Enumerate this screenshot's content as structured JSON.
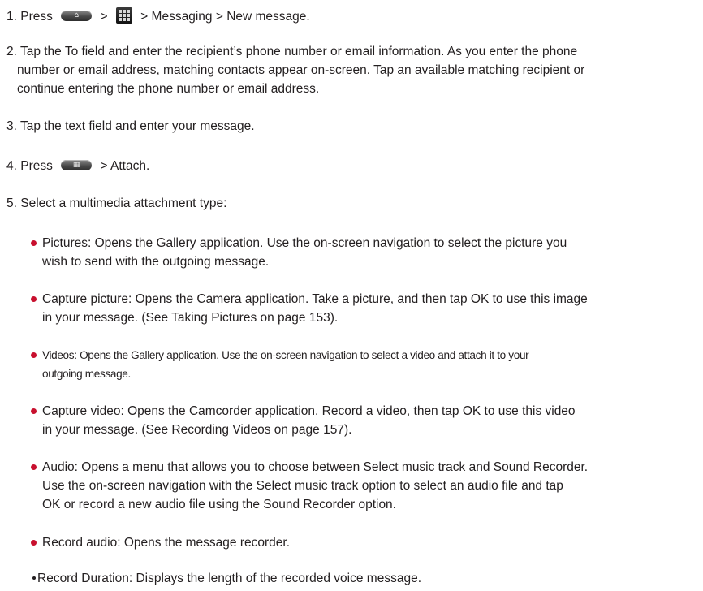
{
  "step1": {
    "num": "1. ",
    "press": "Press",
    "gt1": ">",
    "gt2": ">",
    "messaging": "Messaging",
    "gt3": ">",
    "new_message": "New message",
    "end": "."
  },
  "step2": {
    "line1": "2. Tap the To field and enter the recipient’s phone number or email information. As you enter the phone",
    "line2": "number or email address, matching contacts appear on-screen. Tap an available matching recipient or",
    "line3": "continue entering the phone number or email address."
  },
  "step3": {
    "text": "3. Tap the text field and enter your message."
  },
  "step4": {
    "press": "4. Press",
    "gt": ">",
    "attach": "Attach",
    "end": "."
  },
  "step5": {
    "text": "5. Select a multimedia attachment type:"
  },
  "bullets": {
    "pictures": {
      "term": "Pictures",
      "line1": ": Opens the Gallery application. Use the on-screen navigation to select the picture you",
      "line2": "wish to send with the outgoing message."
    },
    "capture_picture": {
      "term": "Capture picture",
      "line1": ": Opens the Camera application. Take a picture, and then tap OK to use this image",
      "line2": "in your message. (See Taking Pictures on page 153)."
    },
    "videos": {
      "term": "Videos",
      "line1": ": Opens the Gallery application. Use the on-screen navigation to select a video and attach it to your",
      "line2": "outgoing message."
    },
    "capture_video": {
      "term": "Capture video",
      "line1": ": Opens the Camcorder application. Record a video, then tap OK to use this video",
      "line2": "in your message. (See Recording Videos on page 157)."
    },
    "audio": {
      "term": "Audio",
      "line1a": ": Opens a menu that allows you to choose between ",
      "opt1": "Select music track",
      "line1b": " and ",
      "opt2": "Sound Recorder",
      "line1c": ".",
      "line2a": "Use the on-screen navigation with the ",
      "opt3": "Select music track",
      "line2b": " option to select an audio file and tap",
      "line3a": "OK or record a new audio file using the ",
      "opt4": "Sound Recorder",
      "line3b": " option."
    },
    "record_audio": {
      "term": "Record audio",
      "line1": ": Opens the message recorder."
    }
  },
  "sub_bullet": {
    "term": "Record Duration",
    "text": ": Displays the length of the recorded voice message."
  },
  "icons": {
    "home_key": "home-key-icon",
    "apps": "apps-grid-icon",
    "menu_key": "menu-key-icon"
  },
  "colors": {
    "bullet": "#c8102e",
    "text": "#231f20"
  }
}
